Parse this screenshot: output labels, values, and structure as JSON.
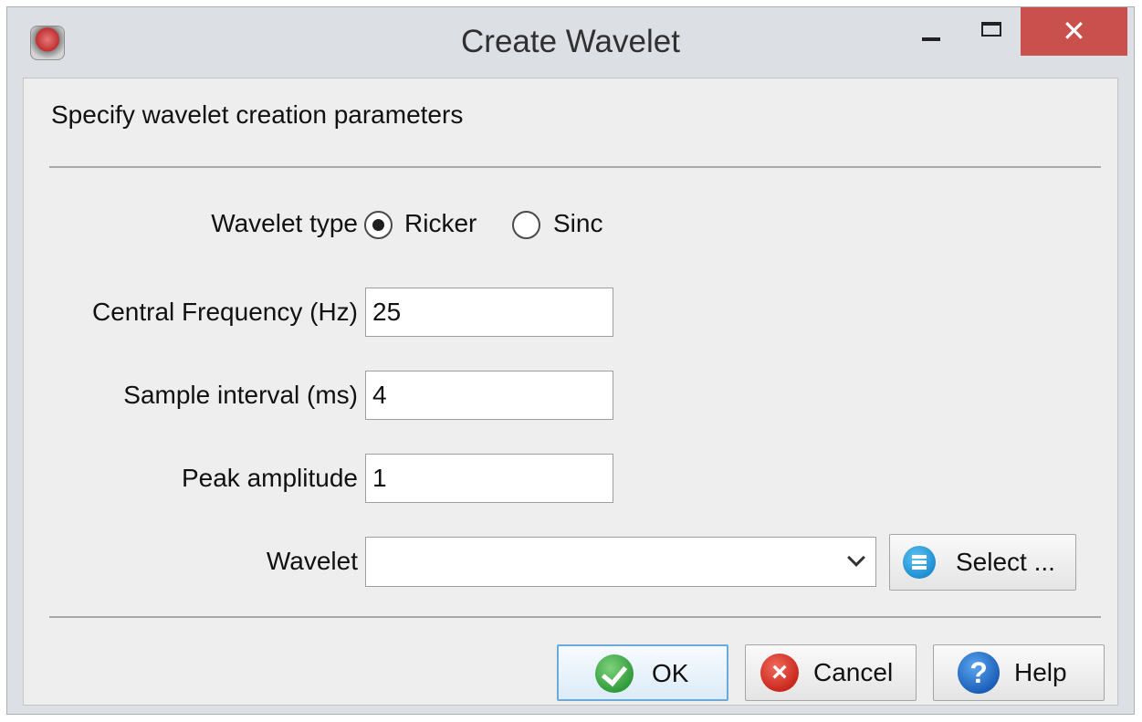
{
  "window": {
    "title": "Create Wavelet",
    "close_glyph": "✕"
  },
  "header": {
    "instructions": "Specify wavelet creation parameters"
  },
  "form": {
    "wavelet_type": {
      "label": "Wavelet type",
      "options": [
        {
          "label": "Ricker",
          "selected": true
        },
        {
          "label": "Sinc",
          "selected": false
        }
      ]
    },
    "central_frequency": {
      "label": "Central Frequency (Hz)",
      "value": "25"
    },
    "sample_interval": {
      "label": "Sample interval (ms)",
      "value": "4"
    },
    "peak_amplitude": {
      "label": "Peak amplitude",
      "value": "1"
    },
    "wavelet": {
      "label": "Wavelet",
      "value": "",
      "select_button": "Select ..."
    }
  },
  "footer": {
    "ok": "OK",
    "cancel": "Cancel",
    "help": "Help",
    "help_glyph": "?",
    "cancel_glyph": "×"
  },
  "icons": {
    "app": "app-icon",
    "select": "list-icon",
    "ok": "check-icon",
    "cancel": "cancel-icon",
    "help": "help-icon"
  },
  "colors": {
    "close_button": "#c9504c",
    "ok_border": "#6ba9d8",
    "ok_icon": "#2f9a3a",
    "cancel_icon": "#c9261d",
    "help_icon": "#1a5db7",
    "select_icon": "#1f8ed1"
  }
}
